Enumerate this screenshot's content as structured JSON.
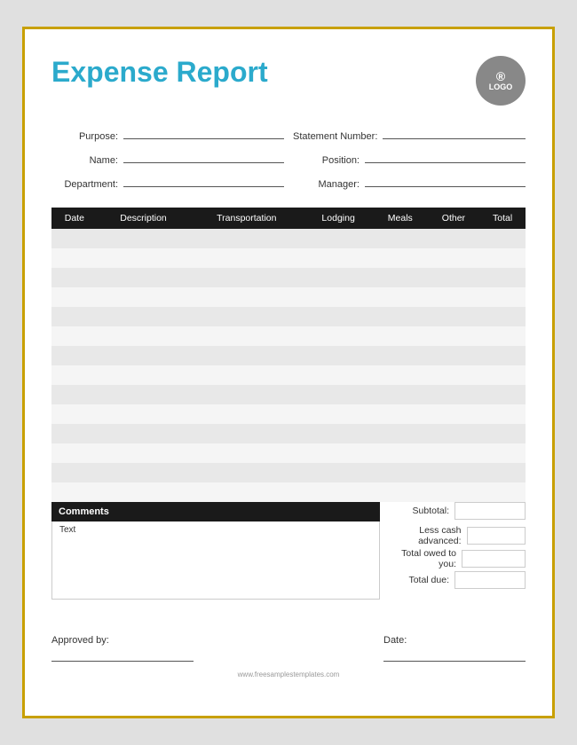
{
  "header": {
    "title": "Expense Report",
    "logo_r": "®",
    "logo_text": "LOGO"
  },
  "form": {
    "purpose_label": "Purpose:",
    "name_label": "Name:",
    "department_label": "Department:",
    "statement_number_label": "Statement Number:",
    "position_label": "Position:",
    "manager_label": "Manager:"
  },
  "table": {
    "columns": [
      "Date",
      "Description",
      "Transportation",
      "Lodging",
      "Meals",
      "Other",
      "Total"
    ],
    "rows": 14
  },
  "summary": {
    "subtotal_label": "Subtotal:",
    "less_cash_label": "Less cash advanced:",
    "total_owed_label": "Total owed to you:",
    "total_due_label": "Total due:"
  },
  "comments": {
    "header_label": "Comments",
    "body_text": "Text"
  },
  "signature": {
    "approved_label": "Approved by:",
    "date_label": "Date:"
  },
  "website": "www.freesamplestemplates.com"
}
